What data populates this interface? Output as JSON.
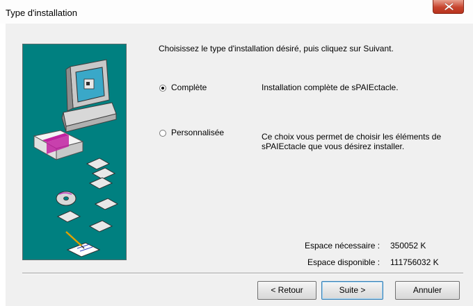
{
  "window": {
    "title": "Type d'installation"
  },
  "instruction": "Choisissez le type d'installation désiré, puis cliquez sur Suivant.",
  "options": [
    {
      "label": "Complète",
      "description_line1": "Installation complète de sPAIEctacle.",
      "description_line2": "",
      "selected": true
    },
    {
      "label": "Personnalisée",
      "description_line1": "Ce choix vous permet de choisir les éléments de",
      "description_line2": "sPAIEctacle que vous désirez installer.",
      "selected": false
    }
  ],
  "space": {
    "required_label": "Espace nécessaire :",
    "required_value": "350052 K",
    "available_label": "Espace disponible :",
    "available_value": "111756032 K"
  },
  "buttons": {
    "back": "< Retour",
    "next": "Suite >",
    "cancel": "Annuler"
  },
  "icons": {
    "close": "close-icon",
    "cursor": "mouse-cursor-icon",
    "illustration": "computer-install-illustration"
  },
  "colors": {
    "illustration_bg": "#008080",
    "dialog_bg": "#f0f0f0",
    "close_button": "#c7452f"
  }
}
